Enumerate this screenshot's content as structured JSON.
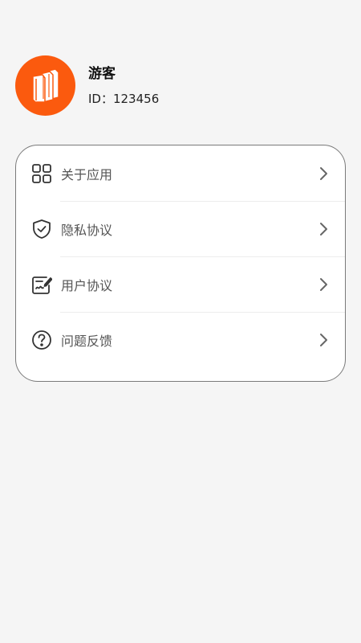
{
  "profile": {
    "name": "游客",
    "id_text": "ID：123456",
    "avatar_color": "#fb5a0e",
    "avatar_icon": "books-icon"
  },
  "menu": {
    "items": [
      {
        "label": "关于应用",
        "icon": "apps-grid-icon"
      },
      {
        "label": "隐私协议",
        "icon": "shield-check-icon"
      },
      {
        "label": "用户协议",
        "icon": "document-sign-icon"
      },
      {
        "label": "问题反馈",
        "icon": "question-circle-icon"
      }
    ]
  }
}
